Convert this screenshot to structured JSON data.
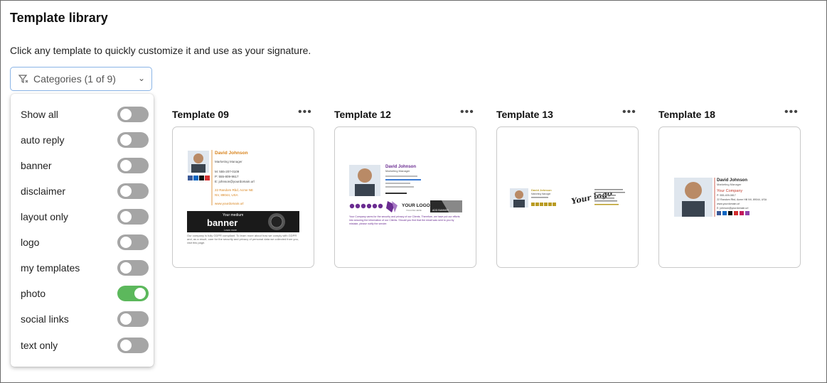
{
  "header": {
    "title": "Template library",
    "subtitle": "Click any template to quickly customize it and use as your signature."
  },
  "filter": {
    "button_label": "Categories (1 of 9)",
    "chevron_icon": "chevron-down-icon",
    "filter_icon": "filter-icon",
    "options": [
      {
        "label": "Show all",
        "on": false
      },
      {
        "label": "auto reply",
        "on": false
      },
      {
        "label": "banner",
        "on": false
      },
      {
        "label": "disclaimer",
        "on": false
      },
      {
        "label": "layout only",
        "on": false
      },
      {
        "label": "logo",
        "on": false
      },
      {
        "label": "my templates",
        "on": false
      },
      {
        "label": "photo",
        "on": true
      },
      {
        "label": "social links",
        "on": false
      },
      {
        "label": "text only",
        "on": false
      }
    ]
  },
  "templates": [
    {
      "name": "Template 09",
      "preview": {
        "person_name": "David Johnson",
        "job_title": "Marketing Manager",
        "phone_m": "M: 555-207-0109",
        "phone_p": "P: 555-809-9617",
        "email": "E: johnson@yourdomain.url",
        "address1": "22 Random Rbd, Acme NE",
        "address2": "NV, 89044, USA",
        "website": "www.yourdomain.url",
        "banner_top": "Your medium",
        "banner_word": "banner",
        "banner_link": "Learn more",
        "disclaimer": "Our company is fully GDPR compliant. To learn more about how we comply with GDPR and, as a result, care for the security and privacy of personal data we collected from you, visit this page."
      }
    },
    {
      "name": "Template 12",
      "preview": {
        "person_name": "David Johnson",
        "job_title": "Marketing Manager",
        "logo_text": "YOUR LOGO",
        "logo_sub": "TAGLINE HERE",
        "banner_text": "ADD BANNER",
        "disclaimer": "Your Company cares for the security and privacy of our Clients. Therefore, we have put our efforts into securing the information of our Clients. Should you find that the email was sent to you by mistake, please notify the sender."
      }
    },
    {
      "name": "Template 13",
      "preview": {
        "person_name": "David Johnson",
        "job_title": "Marketing Manager",
        "logo_script": "Your logo"
      }
    },
    {
      "name": "Template 18",
      "preview": {
        "person_name": "David Johnson",
        "job_title": "Marketing Manager",
        "company": "Your Company",
        "phone": "P: 555-409-0817",
        "address": "22 Random Rbd, Acme Hill NV, 89044, USA",
        "website": "www.yourdomain.url",
        "email": "E: johnson@yourdomain.url"
      }
    }
  ],
  "menu_icon": "more-horizontal-icon",
  "colors": {
    "toggle_on": "#5cb85c",
    "toggle_off": "#a5a5a5",
    "focus_border": "#8ab4e6",
    "t09_accent": "#d8821a",
    "t12_accent": "#6a2c91",
    "t13_accent": "#b99b22",
    "t18_accent": "#c0392b"
  }
}
